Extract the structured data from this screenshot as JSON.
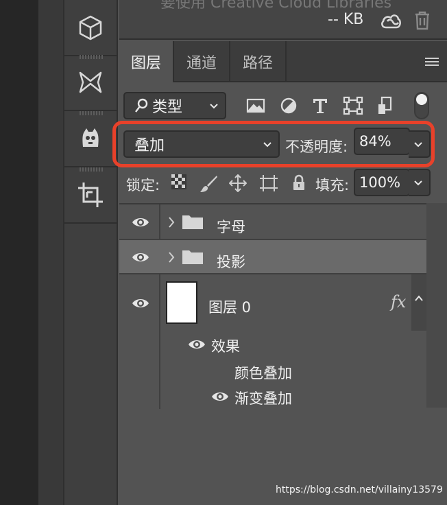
{
  "topbar": {
    "cut_text": "要使用 Creative Cloud Libraries",
    "size": "-- KB"
  },
  "tabs": [
    "图层",
    "通道",
    "路径"
  ],
  "filter": {
    "label": "类型"
  },
  "blend": {
    "mode": "叠加",
    "opacity_label": "不透明度:",
    "opacity_value": "84%"
  },
  "lock": {
    "label": "锁定:",
    "fill_label": "填充:",
    "fill_value": "100%"
  },
  "layers": [
    {
      "name": "字母",
      "type": "group",
      "visible": true,
      "selected": false
    },
    {
      "name": "投影",
      "type": "group",
      "visible": true,
      "selected": true
    },
    {
      "name": "图层 0",
      "type": "layer",
      "visible": true,
      "selected": false,
      "has_fx": true
    }
  ],
  "effects": {
    "label": "效果",
    "items": [
      "颜色叠加",
      "渐变叠加"
    ],
    "visible": [
      false,
      true
    ]
  },
  "fx_label": "fx",
  "watermark": "https://blog.csdn.net/villainy13579",
  "colors": {
    "highlight": "#e8412a",
    "panel": "#535353",
    "selected_row": "#6a6a6a"
  },
  "icons": {
    "tools": [
      "3d-cube-icon",
      "bowtie-warp-icon",
      "puppet-icon",
      "crop-icon"
    ],
    "filters": [
      "image-filter-icon",
      "adjustment-filter-icon",
      "type-filter-icon",
      "shape-filter-icon",
      "smart-object-filter-icon"
    ],
    "locks": [
      "lock-transparency-icon",
      "lock-brush-icon",
      "lock-move-icon",
      "lock-artboard-icon",
      "lock-all-icon"
    ]
  }
}
